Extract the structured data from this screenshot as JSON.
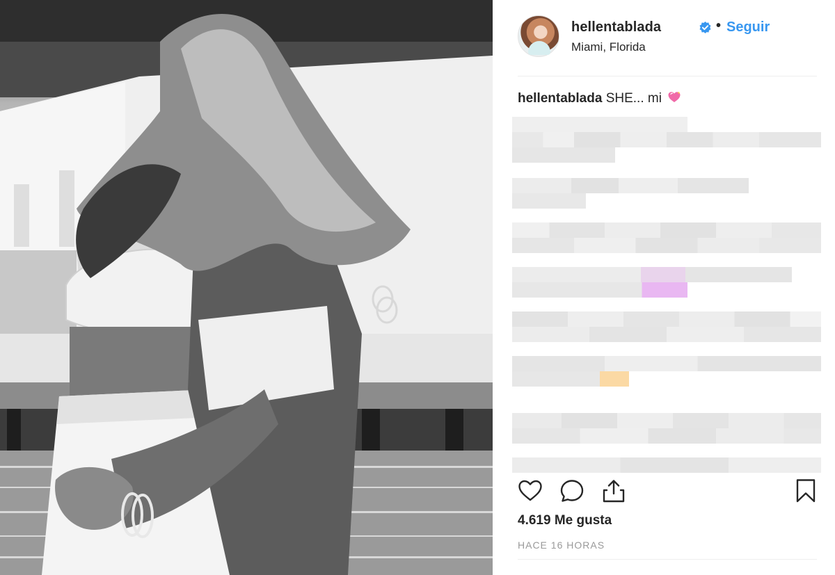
{
  "post": {
    "username": "hellentablada",
    "separator": "•",
    "follow_label": "Seguir",
    "location": "Miami, Florida",
    "caption_user": "hellentablada",
    "caption_text": "SHE... mi",
    "likes": "4.619 Me gusta",
    "time": "HACE 16 HORAS"
  },
  "icons": {
    "verified": "verified-badge-icon",
    "caption_emoji": "sparkling-heart-icon",
    "like": "heart-outline-icon",
    "comment": "comment-bubble-icon",
    "share": "share-upload-icon",
    "save": "bookmark-icon"
  },
  "colors": {
    "link_blue": "#3897f0",
    "text": "#262626",
    "muted": "#999999",
    "divider": "#efefef"
  }
}
